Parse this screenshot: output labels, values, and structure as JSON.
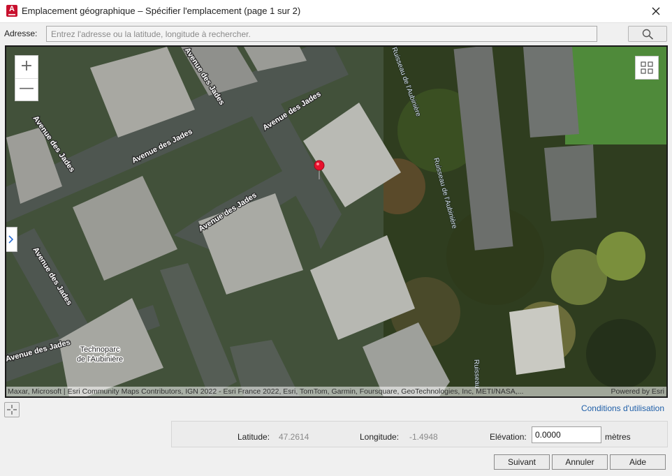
{
  "window": {
    "title": "Emplacement géographique – Spécifier l'emplacement (page 1 sur 2)",
    "app_icon_letter": "A",
    "close_icon": "close-icon"
  },
  "address": {
    "label": "Adresse:",
    "placeholder": "Entrez l'adresse ou la latitude, longitude à rechercher.",
    "value": "",
    "search_icon": "search-icon"
  },
  "map": {
    "zoom_in": "+",
    "zoom_out": "—",
    "labels": {
      "street_1": "Avenue des Jades",
      "street_2": "Avenue des Jades",
      "street_3": "Avenue des Jades",
      "street_4": "Avenue des Jades",
      "street_5": "Avenue des Jades",
      "street_6": "Avenue des Jades",
      "street_7": "Avenue des Jades",
      "street_8": "Avenue des Jades",
      "stream_1": "Ruisseau de l'Aubinière",
      "stream_2": "Ruisseau de l'Aubinière",
      "stream_3": "Ruisseau de l'Aubinière",
      "stream_4": "Ruisseau",
      "place_line1": "Technoparc",
      "place_line2": "de l'Aubinière"
    },
    "attribution": "Maxar, Microsoft | Esri Community Maps Contributors, IGN 2022 - Esri France 2022, Esri, TomTom, Garmin, Foursquare, GeoTechnologies, Inc, METI/NASA,...",
    "powered_by": "Powered by Esri",
    "marker_color": "#e8112d"
  },
  "terms_link": "Conditions d'utilisation",
  "coords": {
    "latitude_label": "Latitude:",
    "latitude_value": "47.2614",
    "longitude_label": "Longitude:",
    "longitude_value": "-1.4948",
    "elevation_label": "Elévation:",
    "elevation_value": "0.0000",
    "elevation_unit": "mètres"
  },
  "buttons": {
    "next": "Suivant",
    "cancel": "Annuler",
    "help": "Aide"
  }
}
